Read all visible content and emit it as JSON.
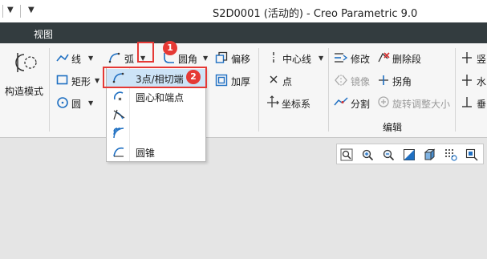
{
  "window": {
    "title": "S2D0001 (活动的) - Creo Parametric 9.0"
  },
  "tabs": {
    "view": "视图"
  },
  "ribbon": {
    "setup": {
      "construction_mode": "构造模式"
    },
    "sketch": {
      "line": "线",
      "rectangle": "矩形",
      "circle": "圆",
      "arc": "弧",
      "fillet": "圆角",
      "offset": "偏移",
      "thicken": "加厚",
      "centerline": "中心线",
      "point": "点",
      "coordinate_system": "坐标系"
    },
    "editing": {
      "modify": "修改",
      "delete_segment": "删除段",
      "mirror": "镜像",
      "corner": "拐角",
      "divide": "分割",
      "rotate_resize": "旋转调整大小",
      "group_label": "编辑"
    },
    "constrain": {
      "vertical": "竖",
      "horizontal": "水",
      "perpendicular": "垂"
    }
  },
  "arc_dropdown": {
    "items": [
      {
        "label": "3点/相切端",
        "highlighted": true
      },
      {
        "label": "圆心和端点",
        "highlighted": false
      },
      {
        "label": "",
        "highlighted": false
      },
      {
        "label": "",
        "highlighted": false
      },
      {
        "label": "圆锥",
        "highlighted": false
      }
    ]
  },
  "callouts": {
    "step1": "1",
    "step2": "2"
  },
  "colors": {
    "accent_red": "#e53935",
    "tabbar_bg": "#333c3f",
    "highlight": "#cde4f7",
    "icon_blue": "#1e6fc2"
  },
  "view_toolbar": {
    "icons": [
      "refit-icon",
      "zoom-in-icon",
      "zoom-out-icon",
      "repaint-icon",
      "display-style-icon",
      "sketch-display-icon",
      "sketch-view-icon"
    ]
  }
}
